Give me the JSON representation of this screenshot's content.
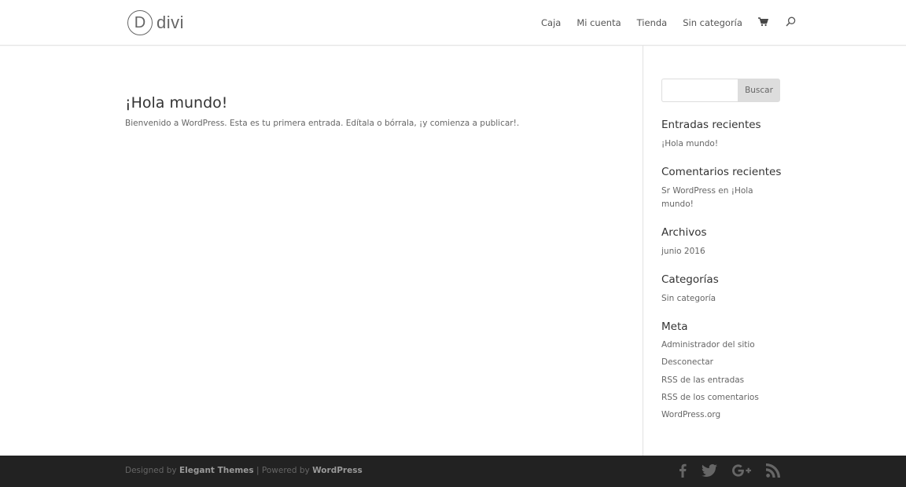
{
  "header": {
    "logo_letter": "D",
    "logo_text": "divi",
    "nav": [
      "Caja",
      "Mi cuenta",
      "Tienda",
      "Sin categoría"
    ],
    "cart_icon": "cart-icon",
    "search_icon": "search-icon"
  },
  "post": {
    "title": "¡Hola mundo!",
    "excerpt": "Bienvenido a WordPress. Esta es tu primera entrada. Edítala o bórrala, ¡y comienza a publicar!."
  },
  "sidebar": {
    "search": {
      "placeholder": "",
      "button_label": "Buscar"
    },
    "recent_posts": {
      "title": "Entradas recientes",
      "items": [
        "¡Hola mundo!"
      ]
    },
    "recent_comments": {
      "title": "Comentarios recientes",
      "item": "Sr WordPress en ¡Hola mundo!"
    },
    "archives": {
      "title": "Archivos",
      "items": [
        "junio 2016"
      ]
    },
    "categories": {
      "title": "Categorías",
      "items": [
        "Sin categoría"
      ]
    },
    "meta": {
      "title": "Meta",
      "items": [
        "Administrador del sitio",
        "Desconectar",
        "RSS de las entradas",
        "RSS de los comentarios",
        "WordPress.org"
      ]
    }
  },
  "footer": {
    "designed_by": "Designed by",
    "elegant_themes": "Elegant Themes",
    "powered_by": " | Powered by",
    "wordpress": "WordPress",
    "socials": [
      "facebook-icon",
      "twitter-icon",
      "google-plus-icon",
      "rss-icon"
    ]
  },
  "colors": {
    "footer_bg": "#222222",
    "text": "#666666",
    "heading": "#333333"
  }
}
